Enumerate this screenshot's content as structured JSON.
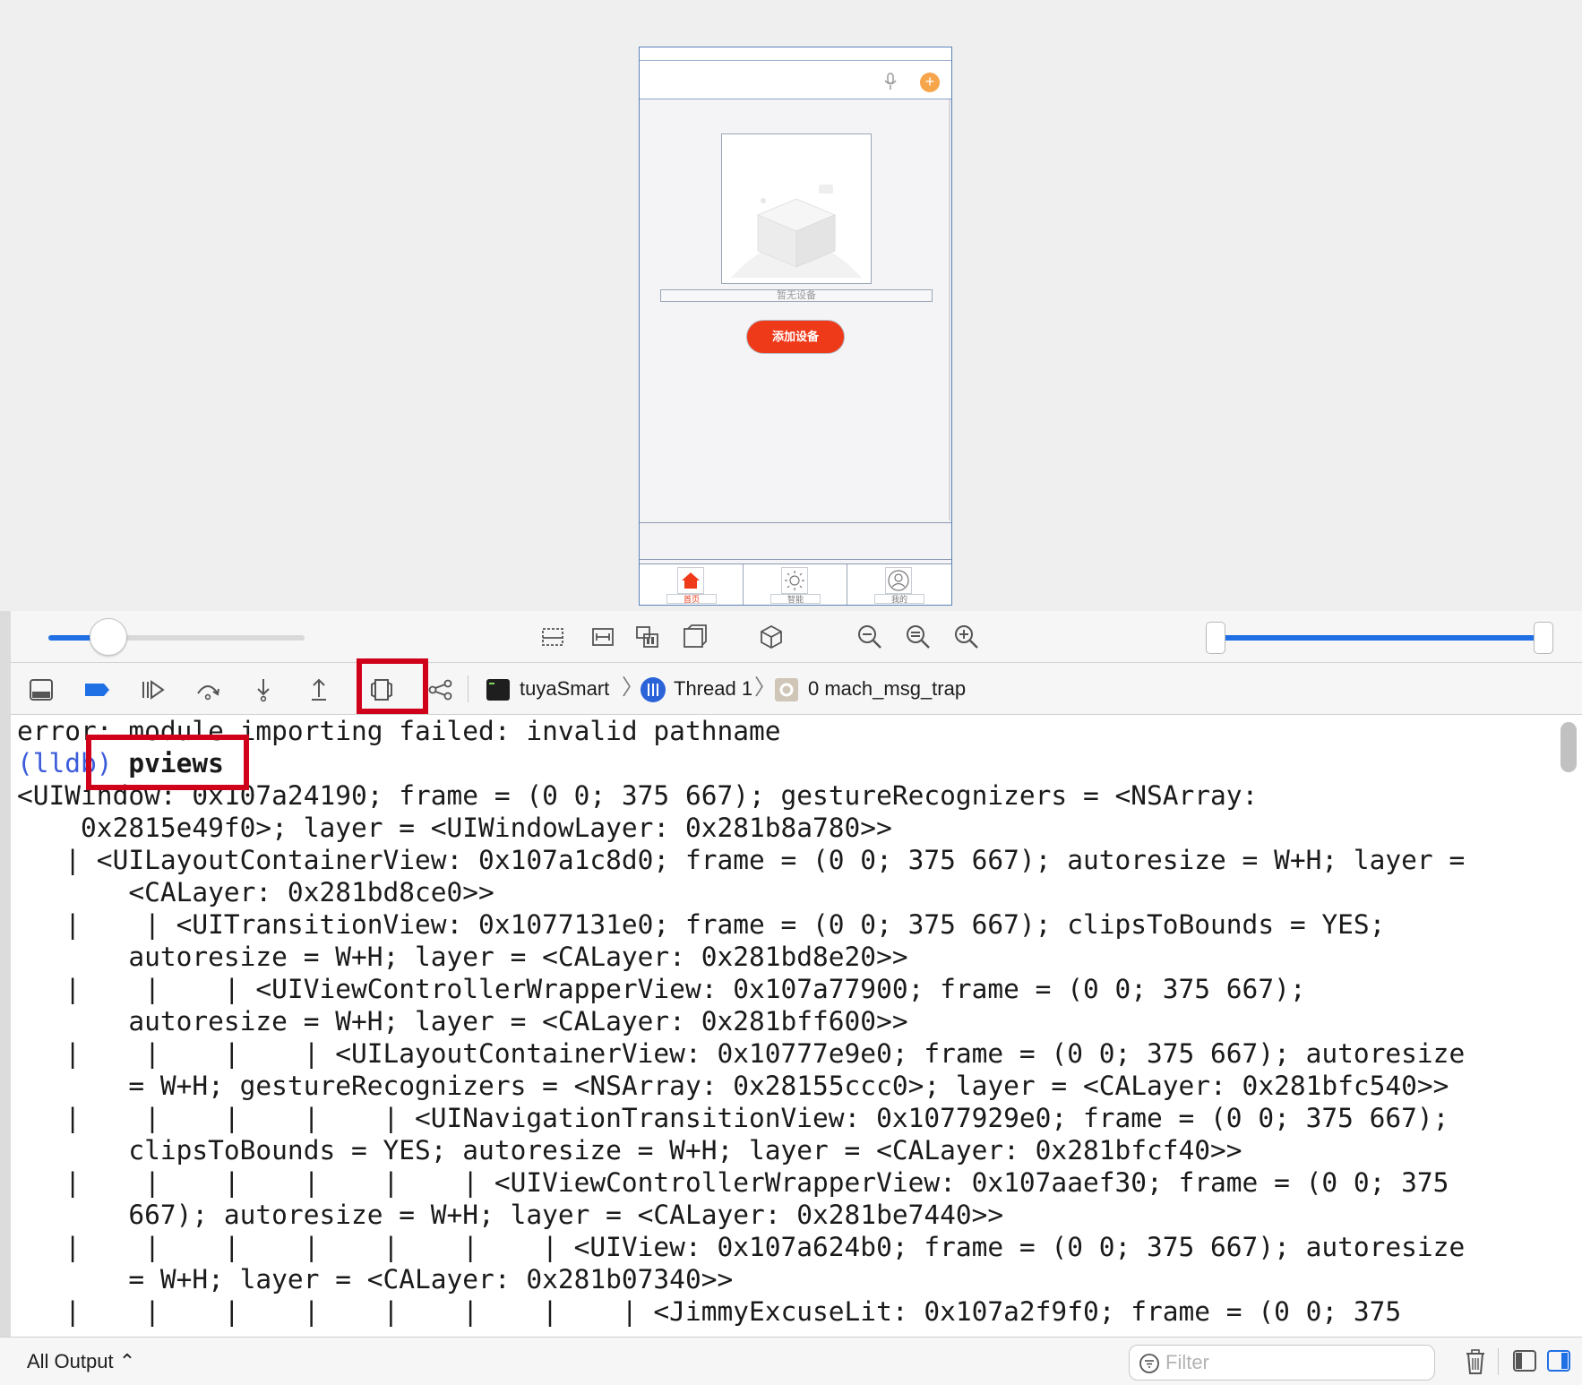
{
  "phone": {
    "empty_label": "暂无设备",
    "add_button": "添加设备",
    "tabs": [
      {
        "label": "首页",
        "icon": "home-icon"
      },
      {
        "label": "智能",
        "icon": "sun-icon"
      },
      {
        "label": "我的",
        "icon": "user-icon"
      }
    ],
    "plus_glyph": "+"
  },
  "debugbar": {
    "breadcrumbs": [
      {
        "label": "tuyaSmart",
        "icon": "terminal-app-icon"
      },
      {
        "label": "Thread 1",
        "icon": "thread-icon"
      },
      {
        "label": "0 mach_msg_trap",
        "icon": "stack-frame-icon"
      }
    ]
  },
  "console": {
    "error_line": "error: module importing failed: invalid pathname",
    "prompt": "(lldb)",
    "command": " pviews",
    "output_lines": [
      "<UIWindow: 0x107a24190; frame = (0 0; 375 667); gestureRecognizers = <NSArray:",
      "    0x2815e49f0>; layer = <UIWindowLayer: 0x281b8a780>>",
      "   | <UILayoutContainerView: 0x107a1c8d0; frame = (0 0; 375 667); autoresize = W+H; layer =",
      "       <CALayer: 0x281bd8ce0>>",
      "   |    | <UITransitionView: 0x1077131e0; frame = (0 0; 375 667); clipsToBounds = YES;",
      "       autoresize = W+H; layer = <CALayer: 0x281bd8e20>>",
      "   |    |    | <UIViewControllerWrapperView: 0x107a77900; frame = (0 0; 375 667);",
      "       autoresize = W+H; layer = <CALayer: 0x281bff600>>",
      "   |    |    |    | <UILayoutContainerView: 0x10777e9e0; frame = (0 0; 375 667); autoresize",
      "       = W+H; gestureRecognizers = <NSArray: 0x28155ccc0>; layer = <CALayer: 0x281bfc540>>",
      "   |    |    |    |    | <UINavigationTransitionView: 0x1077929e0; frame = (0 0; 375 667);",
      "       clipsToBounds = YES; autoresize = W+H; layer = <CALayer: 0x281bfcf40>>",
      "   |    |    |    |    |    | <UIViewControllerWrapperView: 0x107aaef30; frame = (0 0; 375",
      "       667); autoresize = W+H; layer = <CALayer: 0x281be7440>>",
      "   |    |    |    |    |    |    | <UIView: 0x107a624b0; frame = (0 0; 375 667); autoresize",
      "       = W+H; layer = <CALayer: 0x281b07340>>",
      "   |    |    |    |    |    |    |    | <JimmyExcuseLit: 0x107a2f9f0; frame = (0 0; 375"
    ]
  },
  "footer": {
    "output_selector": "All Output ⌃",
    "filter_placeholder": "Filter"
  },
  "colors": {
    "accent": "#1f6fe5",
    "highlight": "#d0021b",
    "add_button": "#ef3a1a",
    "prompt": "#3b5bdb"
  }
}
